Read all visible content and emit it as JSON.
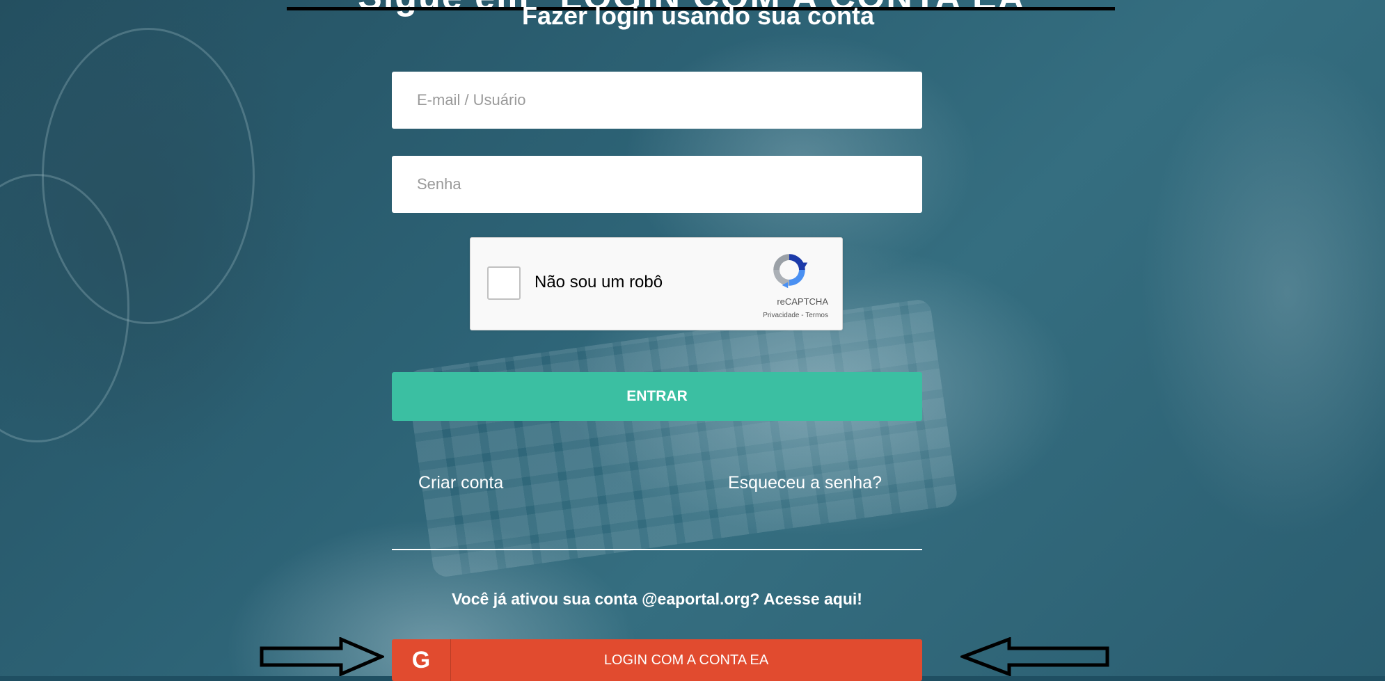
{
  "heading_banner": "Sigue em \"LOGIN COM A CONTA EA\"",
  "title": "Fazer login usando sua conta",
  "form": {
    "email_placeholder": "E-mail / Usuário",
    "password_placeholder": "Senha"
  },
  "captcha": {
    "label": "Não sou um robô",
    "brand": "reCAPTCHA",
    "privacy": "Privacidade",
    "separator": " - ",
    "terms": "Termos"
  },
  "buttons": {
    "enter": "ENTRAR",
    "login_ea": "LOGIN COM A CONTA EA",
    "login_ea_icon_letter": "G"
  },
  "links": {
    "create_account": "Criar conta",
    "forgot_password": "Esqueceu a senha?"
  },
  "note": "Você já ativou sua conta @eaportal.org? Acesse aqui!",
  "icons": [
    "recaptcha-icon",
    "google-g-icon",
    "right-arrow-icon",
    "left-arrow-icon"
  ],
  "colors": {
    "enter_button": "#3bbfa2",
    "ea_button": "#e14b2f",
    "background": "#2d6376"
  }
}
